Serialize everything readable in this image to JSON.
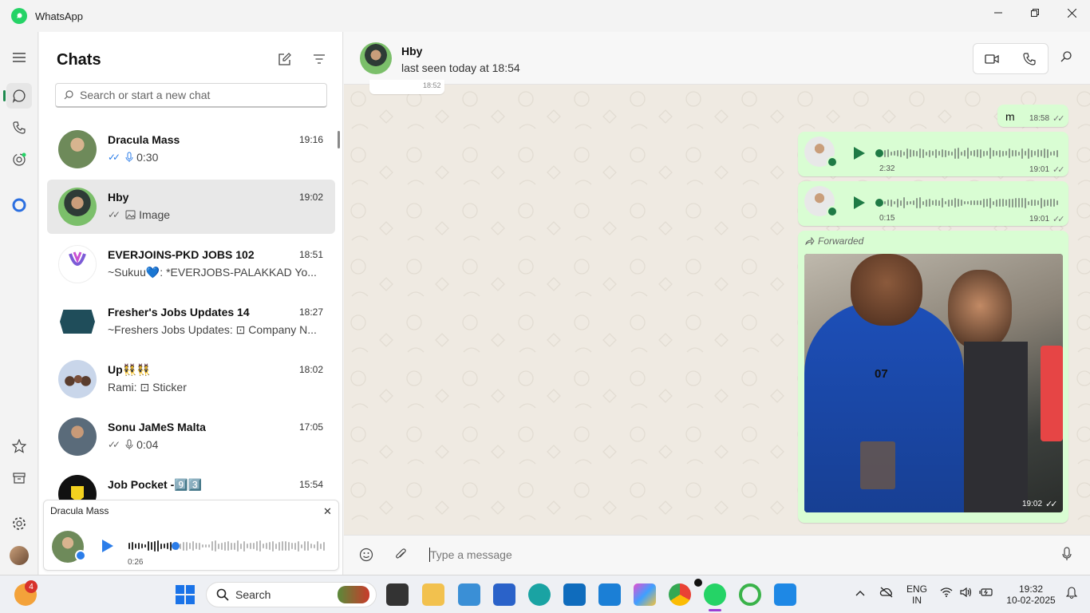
{
  "window": {
    "app_title": "WhatsApp",
    "min_label": "—",
    "max_label": "❐",
    "close_label": "✕"
  },
  "sidebar": {
    "title": "Chats",
    "search_placeholder": "Search or start a new chat"
  },
  "chats": [
    {
      "name": "Dracula Mass",
      "time": "19:16",
      "preview": "0:30",
      "ticks": "✓✓",
      "preview_icon": "mic-icon",
      "avatar_color": "#8a6a4a"
    },
    {
      "name": "Hby",
      "time": "19:02",
      "preview": "Image",
      "ticks": "✓✓",
      "preview_icon": "image-icon",
      "avatar_color": "#3f6b3f",
      "selected": true
    },
    {
      "name": "EVERJOINS-PKD JOBS 102",
      "time": "18:51",
      "preview": "~Sukuu💙: *EVERJOBS-PALAKKAD    Yo...",
      "avatar_color": "#7b5bd6"
    },
    {
      "name": "Fresher's Jobs Updates 14",
      "time": "18:27",
      "preview": "~Freshers Jobs Updates: ⊡ Company N...",
      "avatar_color": "#1f4d5a"
    },
    {
      "name": "Up👯👯",
      "time": "18:02",
      "preview": "Rami: ⊡ Sticker",
      "avatar_color": "#c9d6ea"
    },
    {
      "name": "Sonu JaMeS Malta",
      "time": "17:05",
      "preview": "0:04",
      "ticks": "✓✓",
      "preview_icon": "mic-icon",
      "avatar_color": "#6a5a4a"
    },
    {
      "name": "Job Pocket -9️⃣3️⃣",
      "time": "15:54",
      "preview": "",
      "avatar_color": "#111111"
    }
  ],
  "mini_player": {
    "title": "Dracula Mass",
    "duration": "0:26",
    "close_label": "✕"
  },
  "conversation": {
    "contact_name": "Hby",
    "status": "last seen today at 18:54",
    "messages": [
      {
        "type": "text",
        "text": "m",
        "time": "18:58",
        "ticks": "✓✓"
      },
      {
        "type": "voice",
        "duration": "2:32",
        "time": "19:01",
        "ticks": "✓✓"
      },
      {
        "type": "voice",
        "duration": "0:15",
        "time": "19:01",
        "ticks": "✓✓"
      },
      {
        "type": "image",
        "forwarded_label": "Forwarded",
        "time": "19:02",
        "ticks": "✓✓"
      }
    ],
    "top_cut_time": "18:52",
    "composer_placeholder": "Type a message"
  },
  "taskbar": {
    "notification_badge": "4",
    "search_label": "Search",
    "lang_top": "ENG",
    "lang_bottom": "IN",
    "clock_time": "19:32",
    "clock_date": "10-02-2025"
  },
  "colors": {
    "accent": "#25d366",
    "bubble_out": "#d9fdd3",
    "chat_bg": "#efeae2",
    "play": "#1f7a45"
  }
}
